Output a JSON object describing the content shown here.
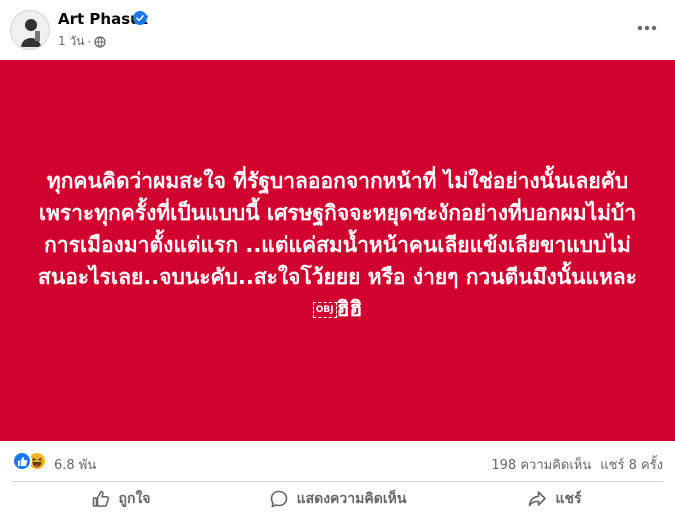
{
  "post": {
    "author": "Art Phasut",
    "timestamp": "1 วัน",
    "meta_separator": "·",
    "verified": true,
    "background_color": "#d2002e",
    "text_before": "ทุกคนคิดว่าผมสะใจ ที่รัฐบาลออกจากหน้าที่ ไม่ใช่อย่างนั้นเลยคับ เพราะทุกครั้งที่เป็นแบบนี้ เศรษฐกิจจะหยุดชะงักอย่างที่บอกผมไม่บ้าการเมืองมาตั้งแต่แรก ..แต่แค่สมน้ำหน้าคนเลียแข้งเลียขาแบบไม่สนอะไรเลย..จบนะคับ..สะใจโว้ยยย หรือ ง่ายๆ กวนตีนมึงนั้นแหละ ",
    "obj_placeholder": "OBJ",
    "text_after": "ฮิฮิ"
  },
  "reactions": {
    "icons": [
      "like-icon",
      "haha-icon"
    ],
    "count": "6.8 พัน"
  },
  "stats": {
    "comments": "198 ความคิดเห็น",
    "shares": "แชร์ 8 ครั้ง"
  },
  "actions": {
    "like_label": "ถูกใจ",
    "comment_label": "แสดงความคิดเห็น",
    "share_label": "แชร์"
  }
}
